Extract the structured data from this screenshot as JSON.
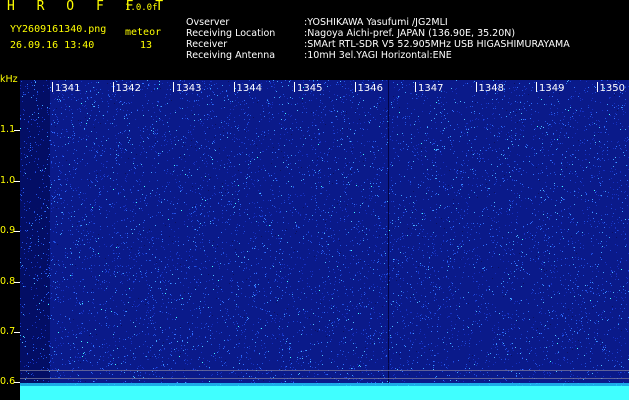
{
  "header": {
    "title": "H R O F F T",
    "version": "1.0.0f",
    "filename": "YY2609161340.png",
    "datetime": "26.09.16 13:40",
    "meteor_label": "meteor",
    "meteor_count": "13"
  },
  "metadata": [
    {
      "key": "Ovserver",
      "value": ":YOSHIKAWA Yasufumi /JG2MLI"
    },
    {
      "key": "Receiving Location",
      "value": ":Nagoya Aichi-pref. JAPAN (136.90E, 35.20N)"
    },
    {
      "key": "Receiver",
      "value": ":SMArt RTL-SDR V5 52.905MHz USB HIGASHIMURAYAMA"
    },
    {
      "key": "Receiving Antenna",
      "value": ":10mH 3el.YAGI Horizontal:ENE"
    }
  ],
  "axis": {
    "y_unit": "kHz",
    "y_ticks": [
      "1.1",
      "1.0",
      "0.9",
      "0.8",
      "0.7",
      "0.6"
    ],
    "x_ticks": [
      "1341",
      "1342",
      "1343",
      "1344",
      "1345",
      "1346",
      "1347",
      "1348",
      "1349",
      "1350"
    ]
  },
  "colors": {
    "background": "#000000",
    "spectro_base": "#0a1a8a",
    "noise_light": "#3fa0ff",
    "noise_cyan": "#40ffff",
    "label_yellow": "#ffff00"
  }
}
